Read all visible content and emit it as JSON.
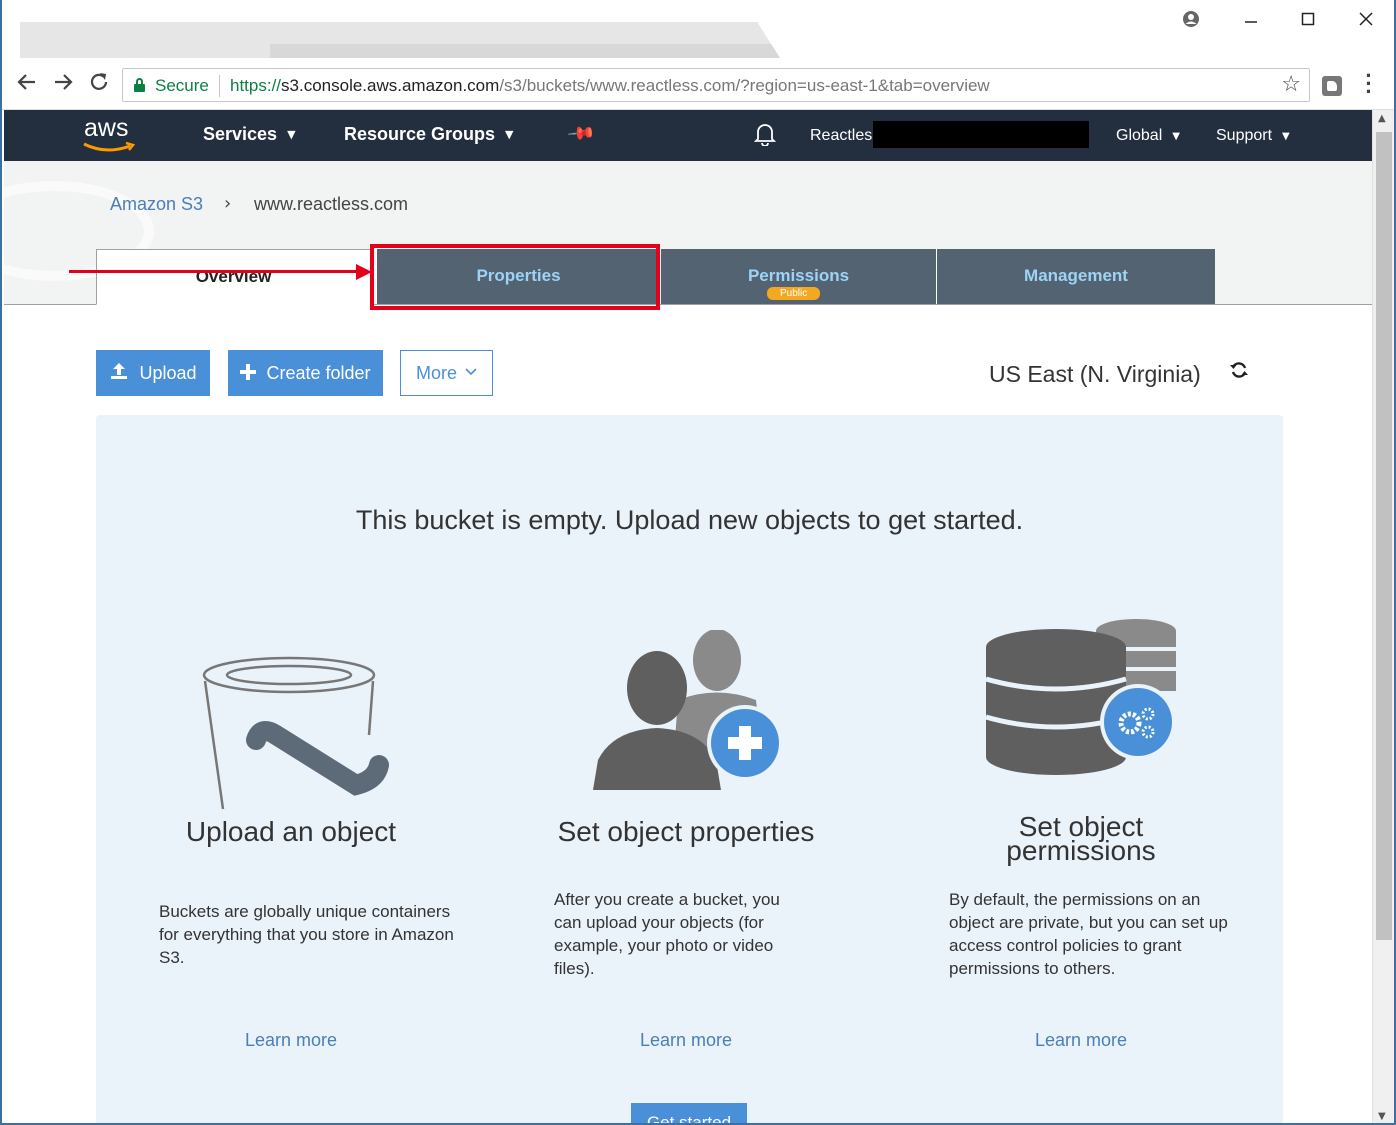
{
  "browser": {
    "url_protocol": "https://",
    "url_host": "s3.console.aws.amazon.com",
    "url_path": "/s3/buckets/www.reactless.com/?region=us-east-1&tab=overview",
    "secure_label": "Secure",
    "icons": [
      "back-arrow-icon",
      "forward-arrow-icon",
      "reload-icon",
      "lock-icon",
      "star-icon",
      "extension-icon",
      "menu-icon",
      "account-icon",
      "minimize-icon",
      "maximize-icon",
      "close-icon"
    ]
  },
  "aws_nav": {
    "logo_text": "aws",
    "services": "Services",
    "resource_groups": "Resource Groups",
    "account": "Reactles",
    "region": "Global",
    "support": "Support",
    "bg_color": "#232f3e"
  },
  "breadcrumb": {
    "root": "Amazon S3",
    "current": "www.reactless.com"
  },
  "tabs": [
    {
      "label": "Overview",
      "active": true
    },
    {
      "label": "Properties",
      "active": false
    },
    {
      "label": "Permissions",
      "active": false,
      "badge": "Public"
    },
    {
      "label": "Management",
      "active": false
    }
  ],
  "actions": {
    "upload": "Upload",
    "create_folder": "Create folder",
    "more": "More",
    "region": "US East (N. Virginia)"
  },
  "empty_state": {
    "message": "This bucket is empty. Upload new objects to get started.",
    "features": [
      {
        "title": "Upload an object",
        "description": "Buckets are globally unique containers for everything that you store in Amazon S3.",
        "link": "Learn more",
        "icon": "bucket-icon"
      },
      {
        "title": "Set object properties",
        "description": "After you create a bucket, you can upload your objects (for example, your photo or video files).",
        "link": "Learn more",
        "icon": "users-add-icon"
      },
      {
        "title_line1": "Set object",
        "title_line2": "permissions",
        "description": "By default, the permissions on an object are private, but you can set up access control policies to grant permissions to others.",
        "link": "Learn more",
        "icon": "database-settings-icon"
      }
    ],
    "get_started": "Get started"
  },
  "colors": {
    "accent": "#4a90d9",
    "tab_dark": "#546372",
    "tab_text": "#9dd3f6",
    "annotation": "#e3001b",
    "badge": "#f2a81f"
  }
}
